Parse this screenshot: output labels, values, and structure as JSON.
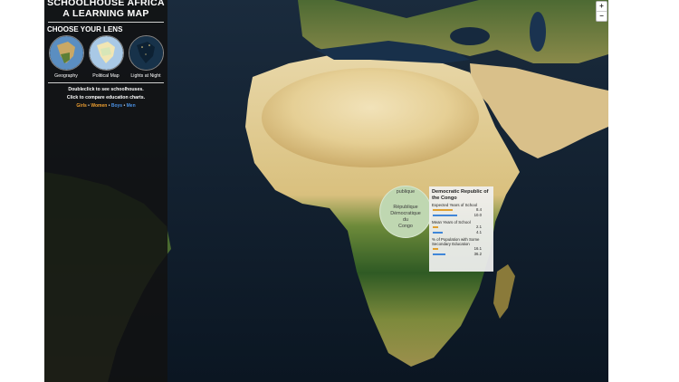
{
  "panel": {
    "title_line1": "SCHOOLHOUSE AFRICA",
    "title_line2": "A LEARNING MAP",
    "lens_heading": "CHOOSE YOUR LENS",
    "lenses": [
      {
        "label": "Geography"
      },
      {
        "label": "Political Map"
      },
      {
        "label": "Lights at Night"
      }
    ],
    "hint_line1": "Doubleclick to see schoolhouses.",
    "hint_line2": "Click to compare education charts.",
    "legend": [
      {
        "label": "Girls",
        "color": "#f0a030"
      },
      {
        "label": "Women",
        "color": "#f0a030"
      },
      {
        "label": "Boys",
        "color": "#4a90e2"
      },
      {
        "label": "Men",
        "color": "#4a90e2"
      }
    ],
    "legend_separator": "•"
  },
  "zoom": {
    "in_label": "+",
    "out_label": "−"
  },
  "lens_circle": {
    "top_label": "publique",
    "lines": [
      "République",
      "Démocratique",
      "du",
      "Congo"
    ]
  },
  "info": {
    "title": "Democratic Republic of the Congo",
    "metrics": [
      {
        "label": "Expected Years of School",
        "bars": [
          {
            "series": "female",
            "value": 8.4
          },
          {
            "series": "male",
            "value": 10.0
          }
        ],
        "value_labels": [
          "8.4",
          "10.0"
        ],
        "max": 15
      },
      {
        "label": "Mean Years of School",
        "bars": [
          {
            "series": "female",
            "value": 2.1
          },
          {
            "series": "male",
            "value": 4.1
          }
        ],
        "value_labels": [
          "2.1",
          "4.1"
        ],
        "max": 15
      },
      {
        "label": "% of Population with Some Secondary Education",
        "bars": [
          {
            "series": "female",
            "value": 16.1
          },
          {
            "series": "male",
            "value": 36.2
          }
        ],
        "value_labels": [
          "16.1",
          "36.2"
        ],
        "max": 100
      }
    ],
    "colors": {
      "female": "#e0a030",
      "male": "#3f86d8"
    }
  }
}
